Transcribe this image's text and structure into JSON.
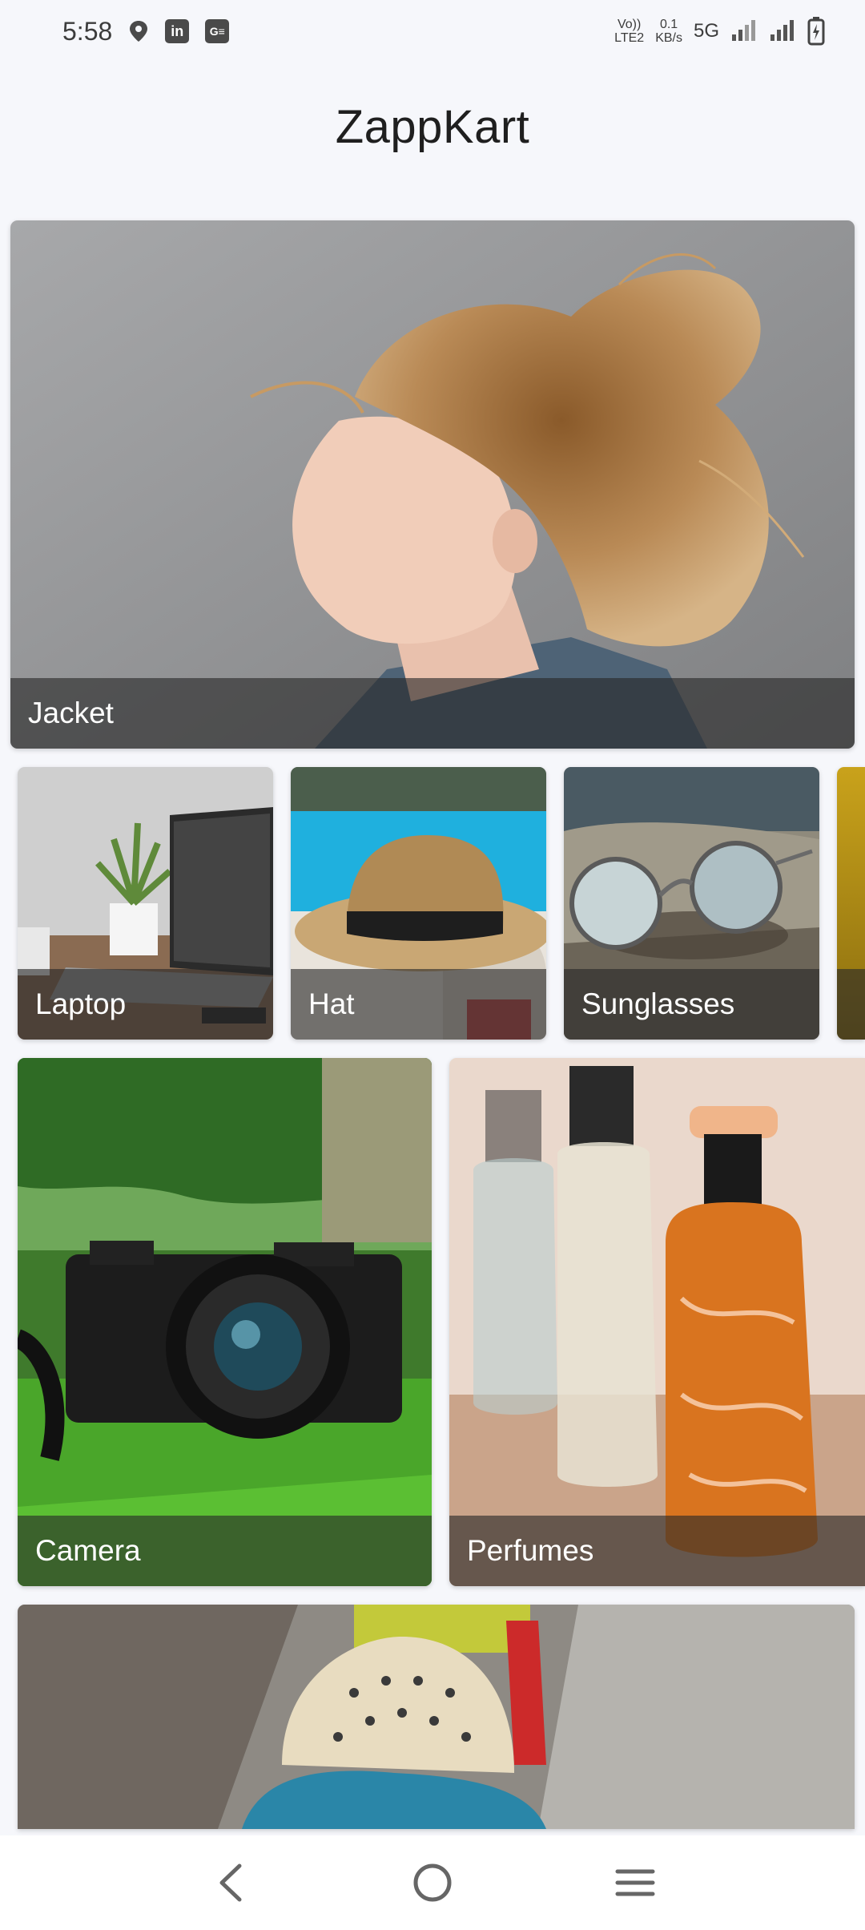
{
  "status": {
    "time": "5:58",
    "volte_top": "Vo))",
    "volte_bottom": "LTE2",
    "speed_top": "0.1",
    "speed_bottom": "KB/s",
    "network": "5G"
  },
  "app": {
    "title": "ZappKart"
  },
  "categories": [
    {
      "label": "Jacket",
      "icon": "woman-profile-image"
    },
    {
      "label": "Laptop",
      "icon": "laptop-image"
    },
    {
      "label": "Hat",
      "icon": "hat-image"
    },
    {
      "label": "Sunglasses",
      "icon": "sunglasses-image"
    },
    {
      "label": "Camera",
      "icon": "camera-image"
    },
    {
      "label": "Perfumes",
      "icon": "perfume-image"
    }
  ],
  "nav": {
    "back": "back-icon",
    "home": "home-icon",
    "menu": "menu-icon"
  }
}
